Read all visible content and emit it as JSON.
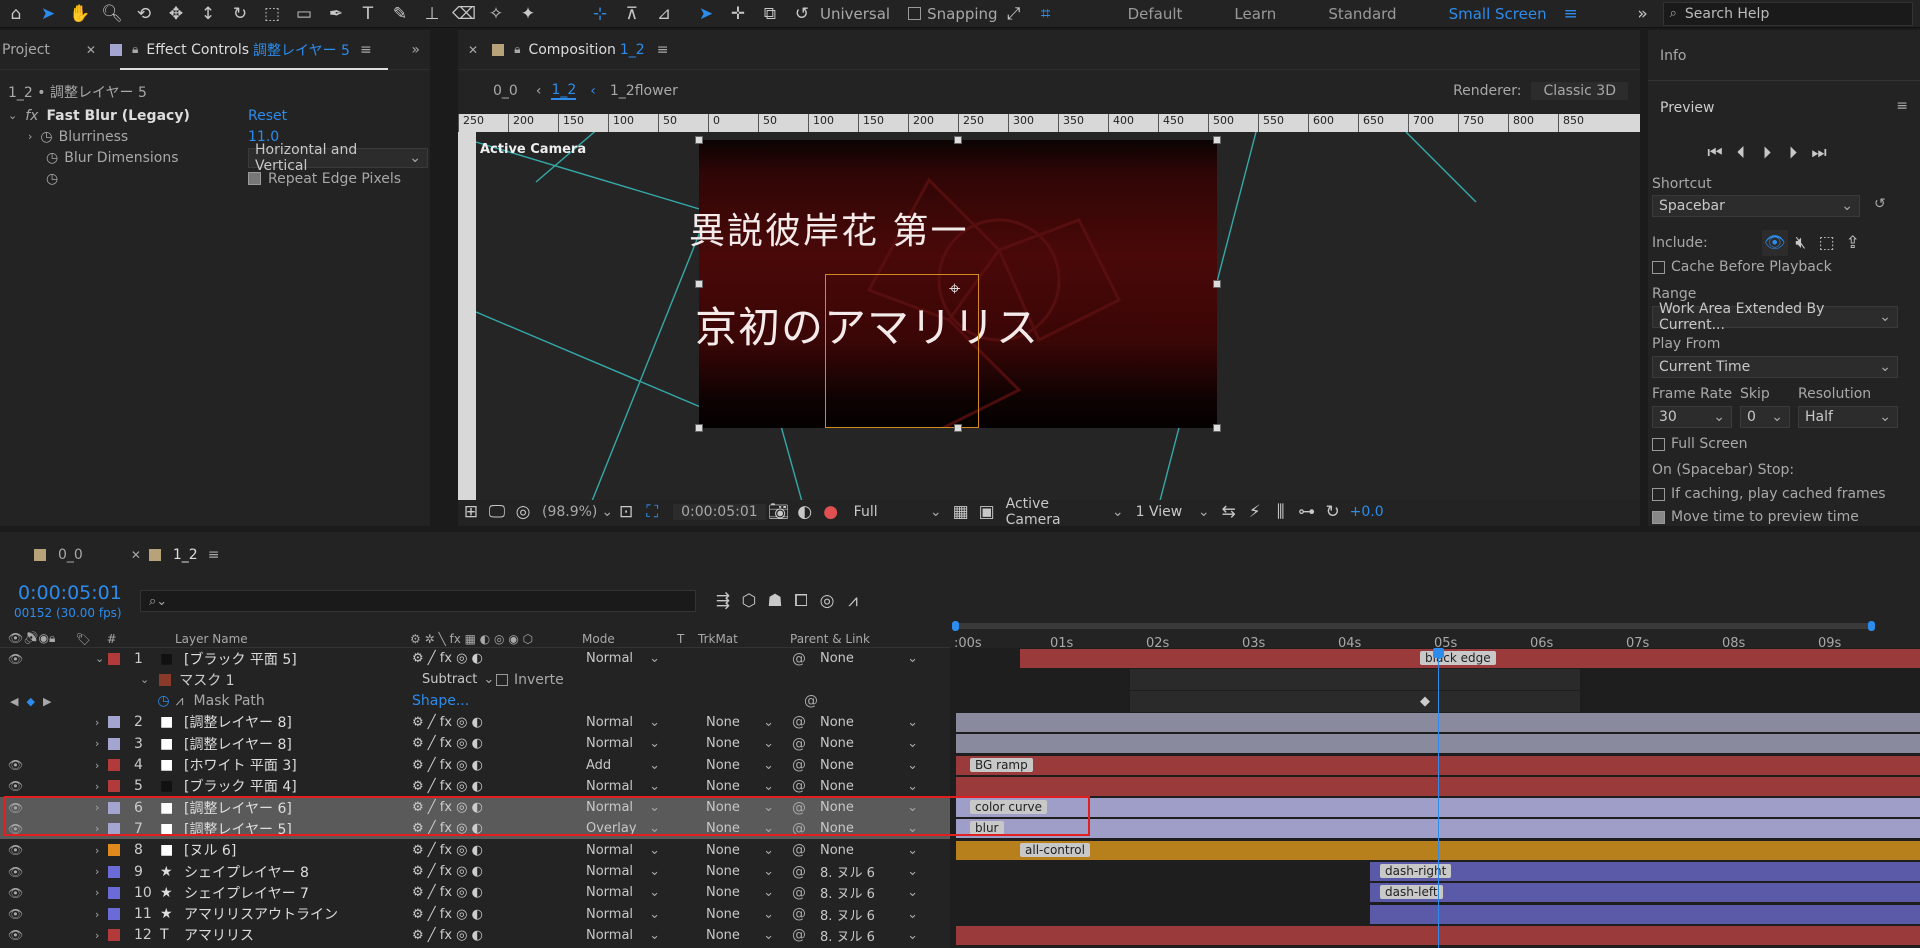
{
  "toolbar": {
    "universal": "Universal",
    "snapping": "Snapping",
    "workspaces": [
      "Default",
      "Learn",
      "Standard",
      "Small Screen"
    ],
    "search_placeholder": "Search Help"
  },
  "left_panel": {
    "project_tab": "Project",
    "effect_tab": "Effect Controls",
    "effect_layer": "調整レイヤー 5",
    "breadcrumb": "1_2 • 調整レイヤー 5",
    "effect_name": "Fast Blur (Legacy)",
    "reset": "Reset",
    "props": [
      {
        "label": "Blurriness",
        "value": "11.0"
      },
      {
        "label": "Blur Dimensions",
        "value": "Horizontal and Vertical"
      },
      {
        "label": "",
        "value": "Repeat Edge Pixels"
      }
    ]
  },
  "comp": {
    "tab": "Composition",
    "tab_name": "1_2",
    "crumbs": [
      "0_0",
      "1_2",
      "1_2flower"
    ],
    "renderer_label": "Renderer:",
    "renderer": "Classic 3D",
    "active_camera": "Active Camera",
    "ruler": [
      "250",
      "200",
      "150",
      "100",
      "50",
      "0",
      "50",
      "100",
      "150",
      "200",
      "250",
      "300",
      "350",
      "400",
      "450",
      "500",
      "550",
      "600",
      "650",
      "700",
      "750",
      "800",
      "850"
    ],
    "text1": "異説彼岸花 第一",
    "text2": "京初のアマリリス",
    "footer": {
      "zoom": "(98.9%)",
      "time": "0:00:05:01",
      "quality": "Full",
      "camera": "Active Camera",
      "view": "1 View",
      "offset": "+0.0"
    }
  },
  "right": {
    "info": "Info",
    "preview": "Preview",
    "shortcut_label": "Shortcut",
    "shortcut": "Spacebar",
    "include": "Include:",
    "cache": "Cache Before Playback",
    "range_label": "Range",
    "range": "Work Area Extended By Current...",
    "playfrom_label": "Play From",
    "playfrom": "Current Time",
    "fr_label": "Frame Rate",
    "skip_label": "Skip",
    "res_label": "Resolution",
    "fr": "30",
    "skip": "0",
    "res": "Half",
    "fullscreen": "Full Screen",
    "stop_label": "On (Spacebar) Stop:",
    "stop1": "If caching, play cached frames",
    "stop2": "Move time to preview time"
  },
  "timeline": {
    "tabs": [
      "0_0",
      "1_2"
    ],
    "timecode": "0:00:05:01",
    "frames": "00152 (30.00 fps)",
    "headers": {
      "layer_name": "Layer Name",
      "mode": "Mode",
      "t": "T",
      "trkmat": "TrkMat",
      "parent": "Parent & Link"
    },
    "ruler": [
      ":00s",
      "01s",
      "02s",
      "03s",
      "04s",
      "05s",
      "06s",
      "07s",
      "08s",
      "09s"
    ],
    "work_markers": [
      "start",
      "1",
      "end"
    ],
    "mask": {
      "name": "マスク 1",
      "mode": "Subtract",
      "invert": "Inverte",
      "path_label": "Mask Path",
      "path_value": "Shape..."
    },
    "layers": [
      {
        "num": "1",
        "name": "[ブラック 平面 5]",
        "mode": "Normal",
        "trk": "",
        "parent": "None",
        "label": "#b23a3a",
        "type": "solid"
      },
      {
        "num": "2",
        "name": "[調整レイヤー 8]",
        "mode": "Normal",
        "trk": "None",
        "parent": "None",
        "label": "#a4a4d0",
        "type": "solid"
      },
      {
        "num": "3",
        "name": "[調整レイヤー 8]",
        "mode": "Normal",
        "trk": "None",
        "parent": "None",
        "label": "#a4a4d0",
        "type": "solid"
      },
      {
        "num": "4",
        "name": "[ホワイト 平面 3]",
        "mode": "Add",
        "trk": "None",
        "parent": "None",
        "label": "#b23a3a",
        "type": "solid"
      },
      {
        "num": "5",
        "name": "[ブラック 平面 4]",
        "mode": "Normal",
        "trk": "None",
        "parent": "None",
        "label": "#b23a3a",
        "type": "solid"
      },
      {
        "num": "6",
        "name": "[調整レイヤー 6]",
        "mode": "Normal",
        "trk": "None",
        "parent": "None",
        "label": "#a4a4d0",
        "type": "solid"
      },
      {
        "num": "7",
        "name": "[調整レイヤー 5]",
        "mode": "Overlay",
        "trk": "None",
        "parent": "None",
        "label": "#a4a4d0",
        "type": "solid"
      },
      {
        "num": "8",
        "name": "[ヌル 6]",
        "mode": "Normal",
        "trk": "None",
        "parent": "None",
        "label": "#e08a1e",
        "type": "solid"
      },
      {
        "num": "9",
        "name": "シェイプレイヤー 8",
        "mode": "Normal",
        "trk": "None",
        "parent": "8. ヌル 6",
        "label": "#6b6bd8",
        "type": "shape"
      },
      {
        "num": "10",
        "name": "シェイプレイヤー 7",
        "mode": "Normal",
        "trk": "None",
        "parent": "8. ヌル 6",
        "label": "#6b6bd8",
        "type": "shape"
      },
      {
        "num": "11",
        "name": "アマリリスアウトライン",
        "mode": "Normal",
        "trk": "None",
        "parent": "8. ヌル 6",
        "label": "#6b6bd8",
        "type": "shape"
      },
      {
        "num": "12",
        "name": "アマリリス",
        "mode": "Normal",
        "trk": "None",
        "parent": "8. ヌル 6",
        "label": "#b23a3a",
        "type": "text"
      }
    ],
    "bar_markers": [
      "black edge",
      "BG ramp",
      "color curve",
      "blur",
      "all-control",
      "dash-right",
      "dash-left"
    ]
  }
}
